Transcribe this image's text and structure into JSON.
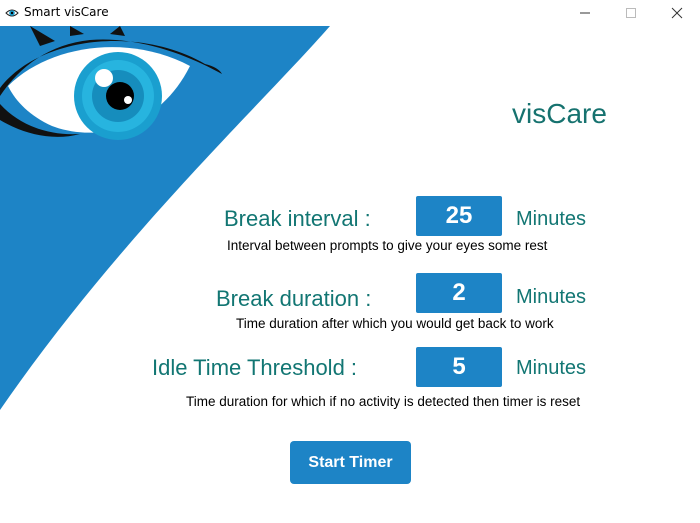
{
  "window": {
    "title": "Smart visCare",
    "icon": "eye-icon",
    "controls": [
      "minimize-icon",
      "maximize-icon",
      "close-icon"
    ]
  },
  "app": {
    "name": "visCare"
  },
  "settings": [
    {
      "label": "Break interval :",
      "value": "25",
      "unit": "Minutes",
      "description": "Interval between prompts to give your eyes some rest"
    },
    {
      "label": "Break duration :",
      "value": "2",
      "unit": "Minutes",
      "description": "Time duration after which you would get back to work"
    },
    {
      "label": "Idle Time Threshold :",
      "value": "5",
      "unit": "Minutes",
      "description": "Time duration for which if no activity is detected then timer is reset"
    }
  ],
  "actions": {
    "start_label": "Start Timer"
  },
  "colors": {
    "accent": "#1d84c6",
    "text_teal": "#127673",
    "iris": "#1a9fcf"
  }
}
